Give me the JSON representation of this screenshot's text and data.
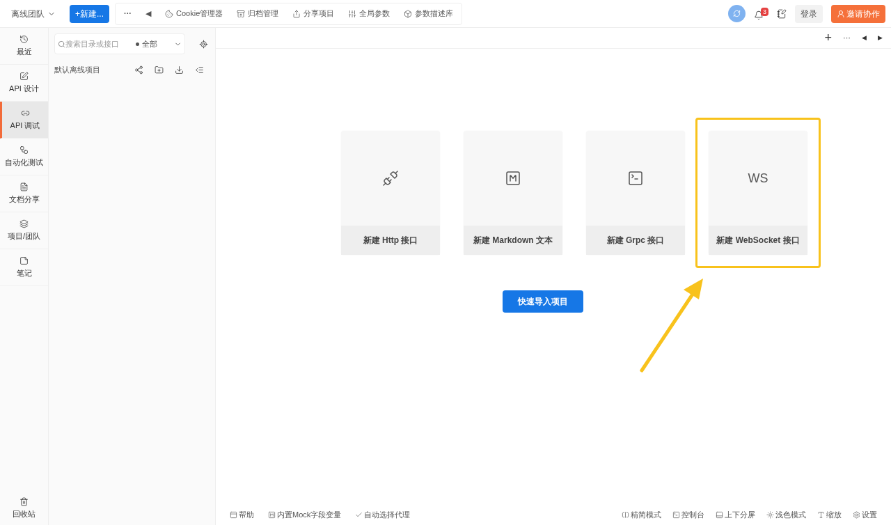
{
  "header": {
    "team": "离线团队",
    "new_button": "+新建...",
    "more": "···",
    "collapse": "◀",
    "tools": [
      "Cookie管理器",
      "归档管理",
      "分享项目",
      "全局参数",
      "参数描述库"
    ],
    "notification_count": "3",
    "login": "登录",
    "invite": "邀请协作"
  },
  "nav": [
    {
      "label": "最近",
      "selected": false
    },
    {
      "label": "API 设计",
      "selected": false
    },
    {
      "label": "API 调试",
      "selected": true
    },
    {
      "label": "自动化测试",
      "selected": false
    },
    {
      "label": "文档分享",
      "selected": false
    },
    {
      "label": "项目/团队",
      "selected": false
    },
    {
      "label": "笔记",
      "selected": false
    }
  ],
  "nav_bottom": "回收站",
  "tree": {
    "search_placeholder": "搜索目录或接口",
    "filter": "全部",
    "project": "默认离线项目"
  },
  "tabs_bar": {
    "add": "+",
    "more": "···",
    "prev": "◀",
    "next": "▶"
  },
  "cards": [
    {
      "label": "新建 Http 接口",
      "kind": "icon",
      "highlighted": false
    },
    {
      "label": "新建 Markdown 文本",
      "kind": "icon",
      "highlighted": false
    },
    {
      "label": "新建 Grpc 接口",
      "kind": "icon",
      "highlighted": false
    },
    {
      "label": "新建 WebSocket 接口",
      "kind": "text",
      "icon_text": "WS",
      "highlighted": true
    }
  ],
  "import_button": "快速导入项目",
  "footer": {
    "left": [
      "帮助",
      "内置Mock字段变量",
      "自动选择代理"
    ],
    "right": [
      "精简模式",
      "控制台",
      "上下分屏",
      "浅色模式",
      "缩放",
      "设置"
    ]
  }
}
